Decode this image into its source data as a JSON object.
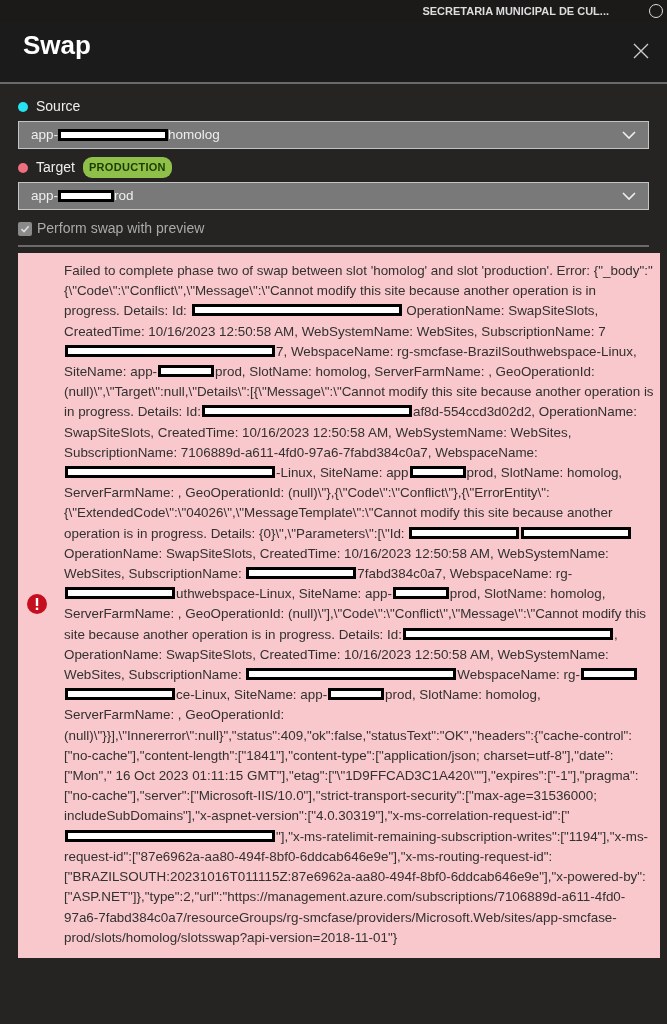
{
  "header": {
    "account": "SECRETARIA MUNICIPAL DE CUL...",
    "title": "Swap"
  },
  "source": {
    "label": "Source",
    "value": [
      {
        "kind": "text",
        "text": "app-"
      },
      {
        "kind": "redacted_medium"
      },
      {
        "kind": "text",
        "text": "homolog"
      }
    ]
  },
  "target": {
    "label": "Target",
    "badge": "PRODUCTION",
    "value": [
      {
        "kind": "text",
        "text": "app-"
      },
      {
        "kind": "redacted_short"
      },
      {
        "kind": "text",
        "text": "rod"
      }
    ]
  },
  "preview": {
    "label": "Perform swap with preview",
    "checked": true,
    "disabled": true
  },
  "error": {
    "segments": [
      {
        "kind": "text",
        "text": "Failed to complete phase two of swap between slot 'homolog' and slot 'production'. Error: {\"_body\":\"{\\\"Code\\\":\\\"Conflict\\\",\\\"Message\\\":\\\"Cannot modify this site because another operation is in progress. Details: Id: "
      },
      {
        "kind": "redacted_long"
      },
      {
        "kind": "text",
        "text": " OperationName: SwapSiteSlots, CreatedTime: 10/16/2023 12:50:58 AM, WebSystemName: WebSites, SubscriptionName: 7"
      },
      {
        "kind": "redacted_long"
      },
      {
        "kind": "text",
        "text": "7, WebspaceName: rg-smcfase-BrazilSouthwebspace-Linux, SiteName: app-"
      },
      {
        "kind": "redacted_short"
      },
      {
        "kind": "text",
        "text": "prod, SlotName: homolog, ServerFarmName: , GeoOperationId: (null)\\\",\\\"Target\\\":null,\\\"Details\\\":[{\\\"Message\\\":\\\"Cannot modify this site because another operation is in progress. Details: Id:"
      },
      {
        "kind": "redacted_long"
      },
      {
        "kind": "text",
        "text": "af8d-554ccd3d02d2, OperationName: SwapSiteSlots, CreatedTime: 10/16/2023 12:50:58 AM, WebSystemName: WebSites, SubscriptionName: 7106889d-a611-4fd0-97a6-7fabd384c0a7, WebspaceName:"
      },
      {
        "kind": "redacted_long"
      },
      {
        "kind": "text",
        "text": "-Linux, SiteName: app"
      },
      {
        "kind": "redacted_short"
      },
      {
        "kind": "text",
        "text": "prod, SlotName: homolog, ServerFarmName: , GeoOperationId: (null)\\\"},{\\\"Code\\\":\\\"Conflict\\\"},{\\\"ErrorEntity\\\":{\\\"ExtendedCode\\\":\\\"04026\\\",\\\"MessageTemplate\\\":\\\"Cannot modify this site because another operation is in progress. Details: {0}\\\",\\\"Parameters\\\":[\\\"Id: "
      },
      {
        "kind": "redacted_medium"
      },
      {
        "kind": "redacted_medium"
      },
      {
        "kind": "text",
        "text": " OperationName: SwapSiteSlots, CreatedTime: 10/16/2023 12:50:58 AM, WebSystemName: WebSites, SubscriptionName: "
      },
      {
        "kind": "redacted_medium"
      },
      {
        "kind": "text",
        "text": "7fabd384c0a7, WebspaceName: rg-"
      },
      {
        "kind": "redacted_medium"
      },
      {
        "kind": "text",
        "text": "uthwebspace-Linux, SiteName: app-"
      },
      {
        "kind": "redacted_short"
      },
      {
        "kind": "text",
        "text": "prod, SlotName: homolog, ServerFarmName: , GeoOperationId: (null)\\\"],\\\"Code\\\":\\\"Conflict\\\",\\\"Message\\\":\\\"Cannot modify this site because another operation is in progress. Details: Id:"
      },
      {
        "kind": "redacted_long"
      },
      {
        "kind": "text",
        "text": ", OperationName: SwapSiteSlots, CreatedTime: 10/16/2023 12:50:58 AM, WebSystemName: WebSites, SubscriptionName: "
      },
      {
        "kind": "redacted_long"
      },
      {
        "kind": "text",
        "text": "WebspaceName: rg-"
      },
      {
        "kind": "redacted_short"
      },
      {
        "kind": "redacted_medium"
      },
      {
        "kind": "text",
        "text": "ce-Linux, SiteName: app-"
      },
      {
        "kind": "redacted_short"
      },
      {
        "kind": "text",
        "text": "prod, SlotName: homolog, ServerFarmName: , GeoOperationId: (null)\\\"}}],\\\"Innererror\\\":null}\",\"status\":409,\"ok\":false,\"statusText\":\"OK\",\"headers\":{\"cache-control\":[\"no-cache\"],\"content-length\":[\"1841\"],\"content-type\":[\"application/json; charset=utf-8\"],\"date\":[\"Mon\",\" 16 Oct 2023 01:11:15 GMT\"],\"etag\":[\"\\\"1D9FFCAD3C1A420\\\"\"],\"expires\":[\"-1\"],\"pragma\":[\"no-cache\"],\"server\":[\"Microsoft-IIS/10.0\"],\"strict-transport-security\":[\"max-age=31536000; includeSubDomains\"],\"x-aspnet-version\":[\"4.0.30319\"],\"x-ms-correlation-request-id\":[\""
      },
      {
        "kind": "redacted_long"
      },
      {
        "kind": "text",
        "text": "\"],\"x-ms-ratelimit-remaining-subscription-writes\":[\"1194\"],\"x-ms-request-id\":[\"87e6962a-aa80-494f-8bf0-6ddcab646e9e\"],\"x-ms-routing-request-id\":[\"BRAZILSOUTH:20231016T011115Z:87e6962a-aa80-494f-8bf0-6ddcab646e9e\"],\"x-powered-by\":[\"ASP.NET\"]},\"type\":2,\"url\":\"https://management.azure.com/subscriptions/7106889d-a611-4fd0-97a6-7fabd384c0a7/resourceGroups/rg-smcfase/providers/Microsoft.Web/sites/app-smcfase-prod/slots/homolog/slotsswap?api-version=2018-11-01\"}"
      }
    ]
  }
}
